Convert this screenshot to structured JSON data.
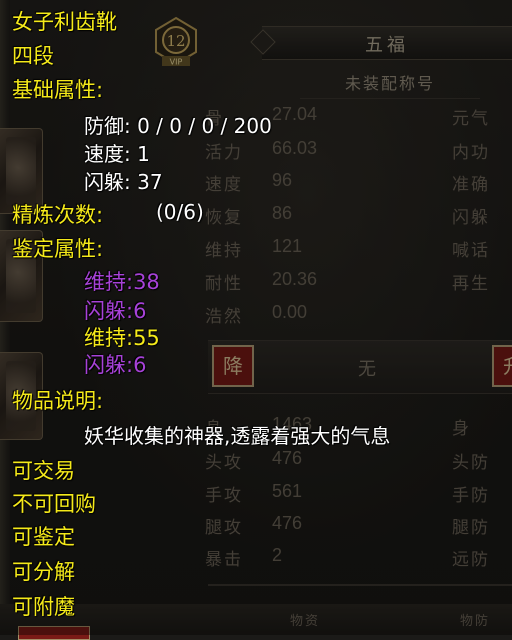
{
  "background": {
    "vip_level": "12",
    "vip_label": "VIP",
    "title": "五福",
    "subtitle": "未装配称号",
    "stats_left": [
      {
        "label": "骨",
        "value": "27.04"
      },
      {
        "label": "活力",
        "value": "66.03"
      },
      {
        "label": "速度",
        "value": "96"
      },
      {
        "label": "恢复",
        "value": "86"
      },
      {
        "label": "维持",
        "value": "121"
      },
      {
        "label": "耐性",
        "value": "20.36"
      },
      {
        "label": "浩然",
        "value": "0.00"
      }
    ],
    "stats_right": [
      "元气",
      "内功",
      "准确",
      "闪躲",
      "喊话",
      "再生"
    ],
    "rank_down": "降",
    "rank_text": "无",
    "rank_up": "升",
    "combat_left": [
      {
        "label": "身",
        "value": "1463"
      },
      {
        "label": "头攻",
        "value": "476"
      },
      {
        "label": "手攻",
        "value": "561"
      },
      {
        "label": "腿攻",
        "value": "476"
      },
      {
        "label": "暴击",
        "value": "2"
      }
    ],
    "combat_right": [
      "身",
      "头防",
      "手防",
      "腿防",
      "远防"
    ],
    "footer_small": [
      "物资",
      "物防"
    ]
  },
  "tooltip": {
    "item_name": "女子利齿靴",
    "grade": "四段",
    "base_header": "基础属性:",
    "base_defense": "防御: 0 / 0 / 0 / 200",
    "base_speed": "速度: 1",
    "base_dodge": "闪躲: 37",
    "refine_label": "精炼次数:",
    "refine_value": "(0/6)",
    "appraise_header": "鉴定属性:",
    "appraise": [
      {
        "text": "维持:38",
        "color": "#a742d8"
      },
      {
        "text": "闪躲:6",
        "color": "#a742d8"
      },
      {
        "text": "维持:55",
        "color": "#f5ea1a"
      },
      {
        "text": "闪躲:6",
        "color": "#a742d8"
      }
    ],
    "desc_header": "物品说明:",
    "desc": "妖华收集的神器,透露着强大的气息",
    "flags": [
      "可交易",
      "不可回购",
      "可鉴定",
      "可分解",
      "可附魔"
    ]
  },
  "colors": {
    "yellow_text": "#f5ea1a",
    "purple_text": "#a742d8",
    "white_text": "#ffffff",
    "red_button": "#7a1b16"
  }
}
